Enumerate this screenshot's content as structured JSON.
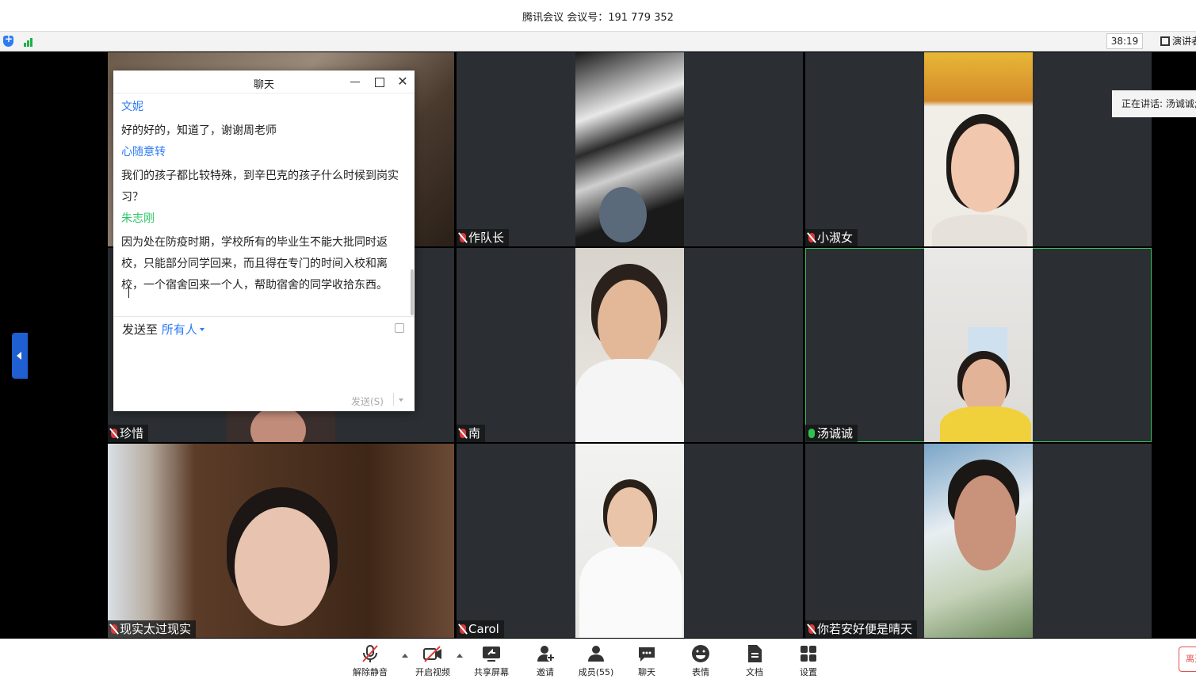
{
  "window": {
    "title": "腾讯会议 会议号：191 779 352"
  },
  "status": {
    "timer": "38:19",
    "speaker_view_label": "演讲者"
  },
  "speaking_banner": "正在讲话: 汤诚诚;",
  "participants": [
    {
      "name": "",
      "mic": "off"
    },
    {
      "name": "作队长",
      "mic": "off"
    },
    {
      "name": "小淑女",
      "mic": "off"
    },
    {
      "name": "珍惜",
      "mic": "off"
    },
    {
      "name": "南",
      "mic": "off"
    },
    {
      "name": "汤诚诚",
      "mic": "on"
    },
    {
      "name": "现实太过现实",
      "mic": "off"
    },
    {
      "name": "Carol",
      "mic": "off"
    },
    {
      "name": "你若安好便是晴天",
      "mic": "off"
    }
  ],
  "chat": {
    "title": "聊天",
    "messages": [
      {
        "sender": "文妮",
        "sender_color": "#2d7cf6",
        "text": "好的好的，知道了，谢谢周老师"
      },
      {
        "sender": "心随意转",
        "sender_color": "#2d7cf6",
        "text": "我们的孩子都比较特殊，到辛巴克的孩子什么时候到岗实习？"
      },
      {
        "sender": "朱志刚",
        "sender_color": "#2cc46a",
        "text": "因为处在防疫时期，学校所有的毕业生不能大批同时返校，只能部分同学回来，而且得在专门的时间入校和离校，一个宿舍回来一个人，帮助宿舍的同学收拾东西。"
      }
    ],
    "send_to_label": "发送至",
    "send_to_target": "所有人",
    "send_button": "发送(S)"
  },
  "toolbar": {
    "unmute": "解除静音",
    "start_video": "开启视频",
    "share_screen": "共享屏幕",
    "invite": "邀请",
    "members": "成员(55)",
    "chat": "聊天",
    "reactions": "表情",
    "docs": "文档",
    "settings": "设置",
    "leave": "离开"
  },
  "colors": {
    "accent": "#2d7cf6",
    "active_speaker": "#35c159",
    "muted": "#d93b3b"
  }
}
